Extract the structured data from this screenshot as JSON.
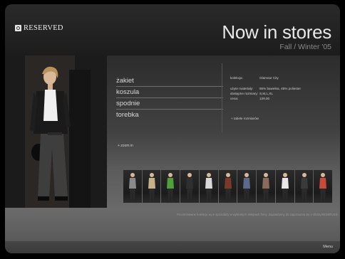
{
  "brand": {
    "name": "RESERVED",
    "icon": "reserved-logo-icon"
  },
  "hero": {
    "title": "Now in stores",
    "subtitle": "Fall / Winter '05"
  },
  "menu": {
    "items": [
      "żakiet",
      "koszula",
      "spodnie",
      "torebka"
    ]
  },
  "zoom_label": "+ zoom in",
  "details": {
    "collection": {
      "label": "kolekcja:",
      "value": "Glamour City"
    },
    "rows": [
      {
        "label": "użyte materiały:",
        "value": "55% bawełna, 45% poliester"
      },
      {
        "label": "dostępne rozmiary:",
        "value": "S,M,L,XL"
      },
      {
        "label": "cena:",
        "value": "129,00"
      }
    ],
    "size_table_link": "+ tabele rozmiarów"
  },
  "thumbnails": {
    "count": 11,
    "colors": [
      "#8a8a8a",
      "#c8b08a",
      "#4fa03a",
      "#2f2f2f",
      "#d9d9d9",
      "#7a3a2a",
      "#5a6a8a",
      "#8a6a5a",
      "#e8e8e8",
      "#3a3a3a",
      "#c84a3a"
    ]
  },
  "footer_note": "Prezentowane kolekcje są w sprzedaży w wybranych sklepach firmy. Zapraszamy do zapoznania się z ofertą RESERVED.",
  "bottom_bar": {
    "menu_label": "Menu"
  },
  "colors": {
    "background": "#000000",
    "panel_top": "#262626",
    "panel_bottom": "#6a6a6a",
    "text": "#e8e8e8",
    "muted": "#8a8a8a"
  }
}
